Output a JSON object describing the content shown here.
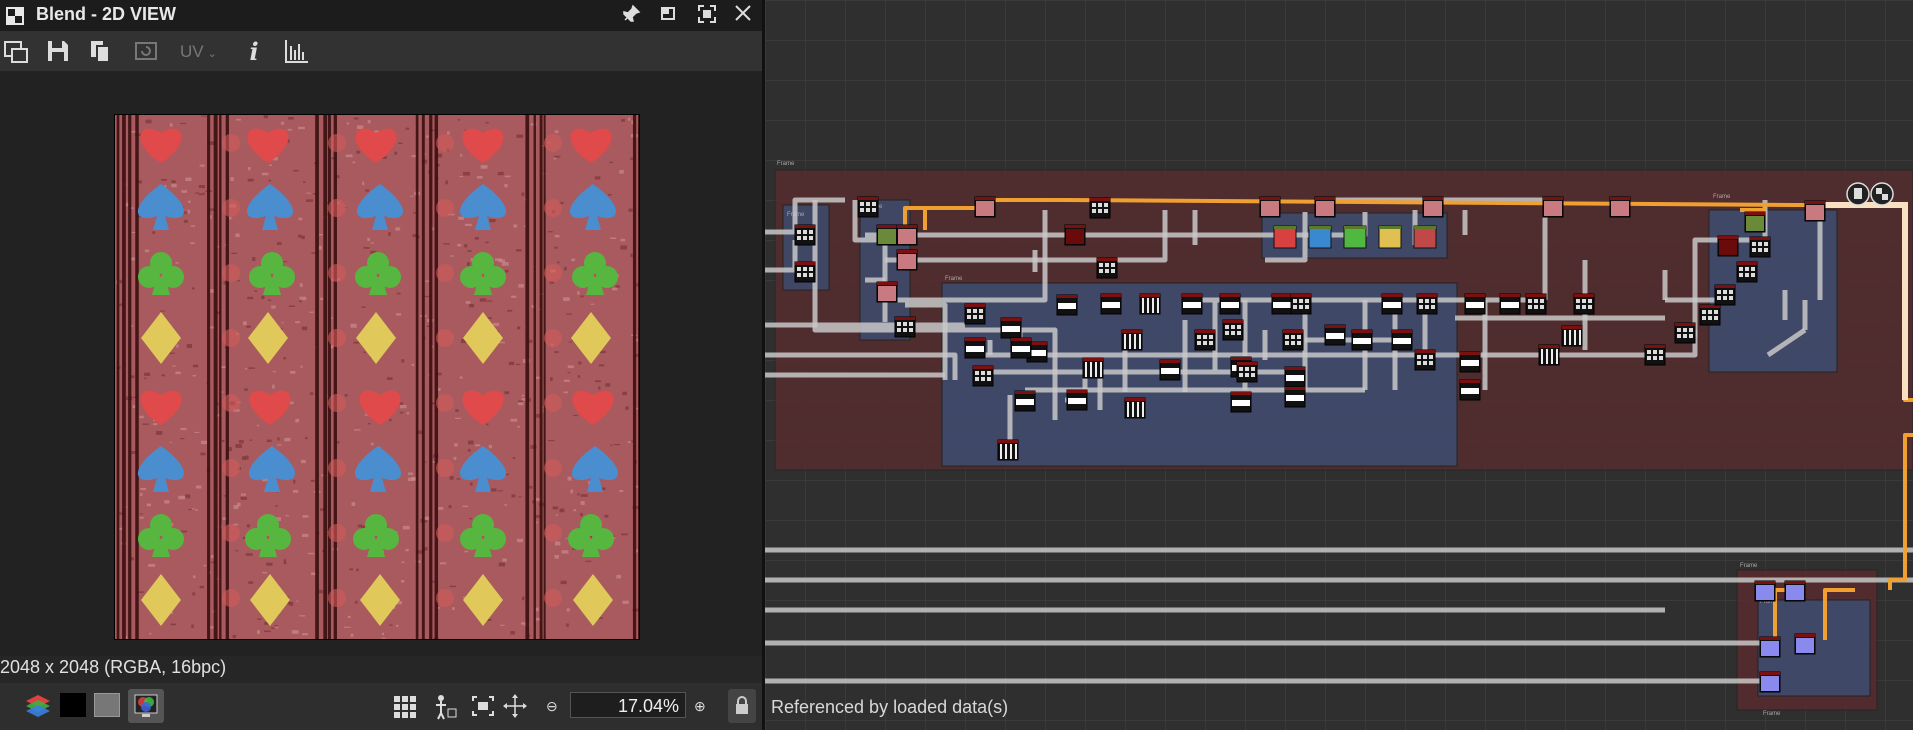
{
  "window": {
    "title": "Blend - 2D VIEW"
  },
  "titlebar_buttons": [
    "pin-icon",
    "restore-icon",
    "maximize-icon",
    "close-icon"
  ],
  "toolbar": {
    "icons": [
      "copy-view-icon",
      "save-icon",
      "copy-icon",
      "refresh-icon",
      "uv-icon",
      "info-icon",
      "histogram-icon"
    ],
    "uv_label": "UV",
    "info_label": "i"
  },
  "texture": {
    "info": "2048 x 2048 (RGBA, 16bpc)",
    "background_color": "#a85a5e",
    "stripe_color": "#3a0e10",
    "symbols": [
      "heart",
      "spade",
      "club",
      "diamond",
      "heart",
      "spade",
      "club",
      "diamond"
    ],
    "symbol_colors": {
      "heart": "#e04a4a",
      "spade": "#4a8ed0",
      "club": "#57b640",
      "diamond": "#e0c85a"
    }
  },
  "bottombar": {
    "icons": [
      "layers-icon",
      "black-swatch-icon",
      "gray-swatch-icon",
      "rgb-display-icon",
      "grid-icon",
      "tile-icon",
      "fit-icon",
      "center-icon",
      "zoom-out-icon",
      "zoom-in-icon",
      "lock-icon"
    ],
    "zoom": "17.04%"
  },
  "graph": {
    "status": "Referenced by loaded data(s)",
    "frame_label": "Frame",
    "link_colors": {
      "main": "#c8c8c8",
      "highlight": "#f0a030"
    },
    "frame_colors": {
      "red": "#5a2b2e",
      "blue": "#3f4a6b"
    },
    "color_nodes": [
      "#d94040",
      "#3a88d0",
      "#50b840",
      "#e0c050",
      "#c04848"
    ]
  }
}
